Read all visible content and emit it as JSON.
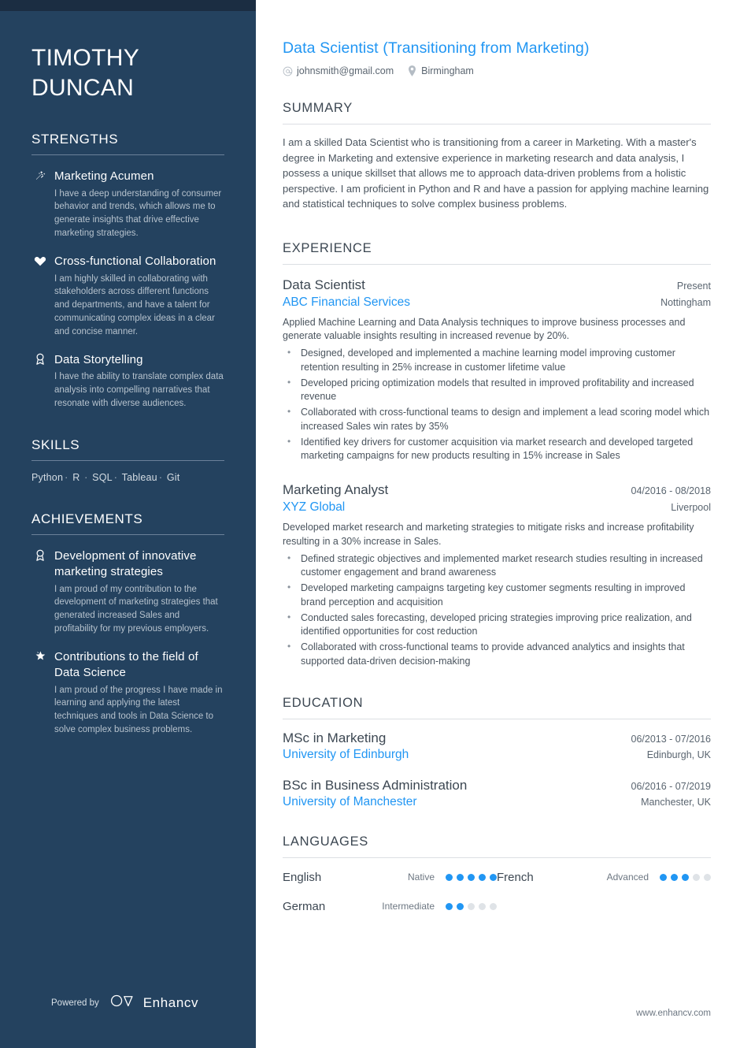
{
  "sidebar": {
    "name_line1": "TIMOTHY",
    "name_line2": "DUNCAN",
    "strengths_heading": "STRENGTHS",
    "strengths": [
      {
        "icon": "magic-wand-icon",
        "title": "Marketing Acumen",
        "desc": "I have a deep understanding of consumer behavior and trends, which allows me to generate insights that drive effective marketing strategies."
      },
      {
        "icon": "heart-icon",
        "title": "Cross-functional Collaboration",
        "desc": "I am highly skilled in collaborating with stakeholders across different functions and departments, and have a talent for communicating complex ideas in a clear and concise manner."
      },
      {
        "icon": "award-ribbon-icon",
        "title": "Data Storytelling",
        "desc": "I have the ability to translate complex data analysis into compelling narratives that resonate with diverse audiences."
      }
    ],
    "skills_heading": "SKILLS",
    "skills": [
      "Python",
      "R",
      "SQL",
      "Tableau",
      "Git"
    ],
    "skills_separator": "·",
    "achievements_heading": "ACHIEVEMENTS",
    "achievements": [
      {
        "icon": "award-ribbon-icon",
        "title": "Development of innovative marketing strategies",
        "desc": "I am proud of my contribution to the development of marketing strategies that generated increased Sales and profitability for my previous employers."
      },
      {
        "icon": "star-icon",
        "title": "Contributions to the field of Data Science",
        "desc": "I am proud of the progress I have made in learning and applying the latest techniques and tools in Data Science to solve complex business problems."
      }
    ],
    "powered_by_label": "Powered by",
    "brand_name": "Enhancv",
    "brand_logo_icon": "enhancv-logo-icon"
  },
  "header": {
    "job_title": "Data Scientist (Transitioning from Marketing)",
    "email": "johnsmith@gmail.com",
    "email_icon": "at-sign-icon",
    "location": "Birmingham",
    "location_icon": "map-pin-icon"
  },
  "summary": {
    "heading": "SUMMARY",
    "text": "I am a skilled Data Scientist who is transitioning from a career in Marketing. With a master's degree in Marketing and extensive experience in marketing research and data analysis, I possess a unique skillset that allows me to approach data-driven problems from a holistic perspective. I am proficient in Python and R and have a passion for applying machine learning and statistical techniques to solve complex business problems."
  },
  "experience": {
    "heading": "EXPERIENCE",
    "entries": [
      {
        "role": "Data Scientist",
        "date": "Present",
        "company": "ABC Financial Services",
        "location": "Nottingham",
        "intro": "Applied Machine Learning and Data Analysis techniques to improve business processes and generate valuable insights resulting in increased revenue by 20%.",
        "bullets": [
          "Designed, developed and implemented a machine learning model improving customer retention resulting in 25% increase in customer lifetime value",
          "Developed pricing optimization models that resulted in improved profitability and increased revenue",
          "Collaborated with cross-functional teams to design and implement a lead scoring model which increased Sales win rates by 35%",
          "Identified key drivers for customer acquisition via market research and developed targeted marketing campaigns for new products resulting in 15% increase in Sales"
        ]
      },
      {
        "role": "Marketing Analyst",
        "date": "04/2016 - 08/2018",
        "company": "XYZ Global",
        "location": "Liverpool",
        "intro": "Developed market research and marketing strategies to mitigate risks and increase profitability resulting in a 30% increase in Sales.",
        "bullets": [
          "Defined strategic objectives and implemented market research studies resulting in increased customer engagement and brand awareness",
          "Developed marketing campaigns targeting key customer segments resulting in improved brand perception and acquisition",
          "Conducted sales forecasting, developed pricing strategies improving price realization, and identified opportunities for cost reduction",
          "Collaborated with cross-functional teams to provide advanced analytics and insights that supported data-driven decision-making"
        ]
      }
    ]
  },
  "education": {
    "heading": "EDUCATION",
    "entries": [
      {
        "degree": "MSc in Marketing",
        "date": "06/2013 - 07/2016",
        "school": "University of Edinburgh",
        "location": "Edinburgh, UK"
      },
      {
        "degree": "BSc in Business Administration",
        "date": "06/2016 - 07/2019",
        "school": "University of Manchester",
        "location": "Manchester, UK"
      }
    ]
  },
  "languages": {
    "heading": "LANGUAGES",
    "max_dots": 5,
    "entries": [
      {
        "name": "English",
        "level": "Native",
        "filled": 5
      },
      {
        "name": "French",
        "level": "Advanced",
        "filled": 3
      },
      {
        "name": "German",
        "level": "Intermediate",
        "filled": 2
      }
    ]
  },
  "footer": {
    "website": "www.enhancv.com"
  },
  "colors": {
    "sidebar_bg": "#24425f",
    "sidebar_top_band": "#1b2d42",
    "accent_blue": "#2196f3",
    "heading_gray": "#3c4752",
    "body_gray": "#4a545e",
    "dot_empty": "#dfe3e7"
  }
}
